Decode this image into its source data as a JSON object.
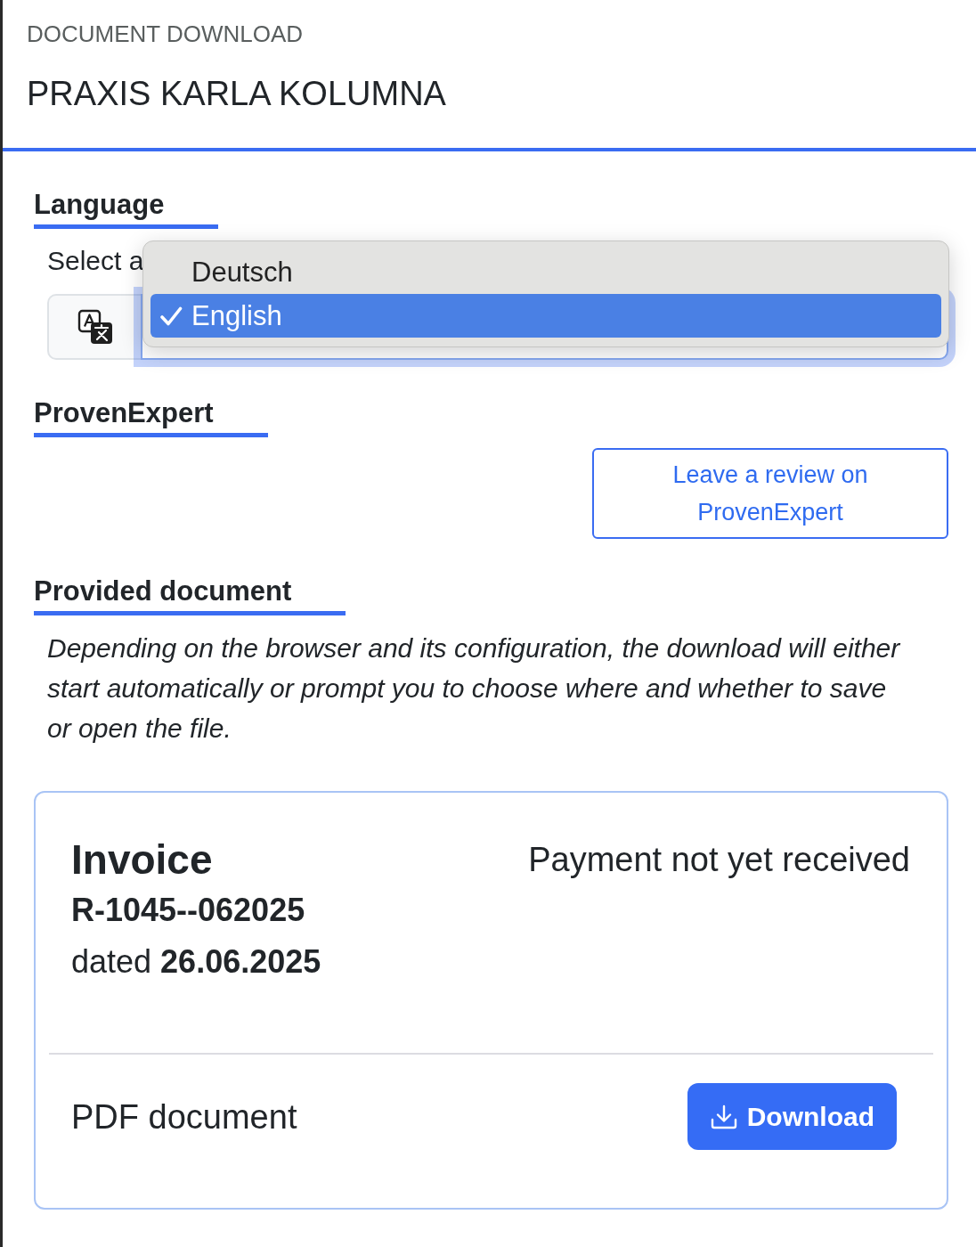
{
  "header": {
    "kicker": "DOCUMENT DOWNLOAD",
    "title": "PRAXIS KARLA KOLUMNA"
  },
  "language": {
    "heading": "Language",
    "label": "Select a",
    "expanded": true,
    "options": [
      {
        "label": "Deutsch",
        "selected": false
      },
      {
        "label": "English",
        "selected": true
      }
    ]
  },
  "proven_expert": {
    "heading": "ProvenExpert",
    "button": "Leave a review on ProvenExpert"
  },
  "provided_document": {
    "heading": "Provided document",
    "note": "Depending on the browser and its configuration, the download will either start automatically or prompt you to choose where and whether to save or open the file.",
    "document": {
      "type": "Invoice",
      "number": "R-1045--062025",
      "date_line": "dated **26.06.2025**",
      "status": "Payment not yet received",
      "file_label": "PDF document",
      "button": "Download"
    }
  }
}
